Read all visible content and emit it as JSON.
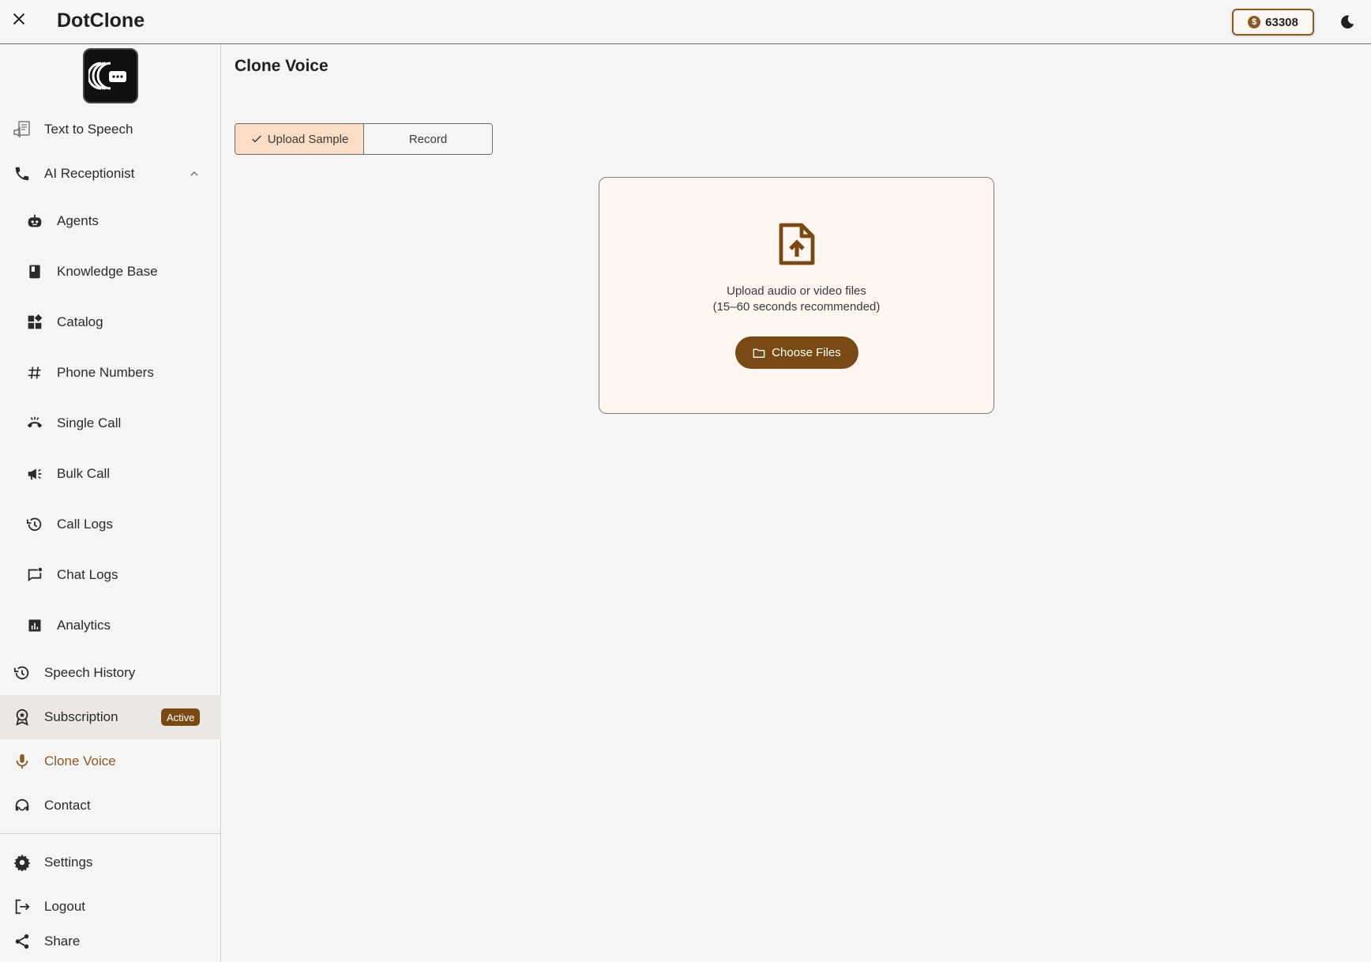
{
  "header": {
    "title": "DotClone",
    "credits": "63308",
    "close_icon": "close-icon",
    "theme_icon": "moon-icon"
  },
  "sidebar": {
    "items": [
      {
        "label": "Text to Speech",
        "icon": "text-to-speech-icon"
      },
      {
        "label": "AI Receptionist",
        "icon": "phone-icon"
      },
      {
        "label": "Agents",
        "icon": "robot-icon"
      },
      {
        "label": "Knowledge Base",
        "icon": "book-icon"
      },
      {
        "label": "Catalog",
        "icon": "widgets-icon"
      },
      {
        "label": "Phone Numbers",
        "icon": "hash-icon"
      },
      {
        "label": "Single Call",
        "icon": "call-end-icon"
      },
      {
        "label": "Bulk Call",
        "icon": "megaphone-icon"
      },
      {
        "label": "Call Logs",
        "icon": "history-icon"
      },
      {
        "label": "Chat Logs",
        "icon": "chat-icon"
      },
      {
        "label": "Analytics",
        "icon": "analytics-icon"
      },
      {
        "label": "Speech History",
        "icon": "history-icon"
      },
      {
        "label": "Subscription",
        "icon": "award-icon",
        "badge": "Active"
      },
      {
        "label": "Clone Voice",
        "icon": "mic-icon"
      },
      {
        "label": "Contact",
        "icon": "support-icon"
      },
      {
        "label": "Settings",
        "icon": "gear-icon"
      },
      {
        "label": "Logout",
        "icon": "logout-icon"
      },
      {
        "label": "Share",
        "icon": "share-icon"
      }
    ]
  },
  "main": {
    "title": "Clone Voice",
    "tabs": [
      {
        "label": "Upload Sample",
        "selected": true
      },
      {
        "label": "Record",
        "selected": false
      }
    ],
    "upload": {
      "line1": "Upload audio or video files",
      "line2": "(15–60 seconds recommended)",
      "button": "Choose Files"
    }
  },
  "colors": {
    "accent": "#8a5a22",
    "accent_dark": "#7a4a14",
    "tab_selected_bg": "#fbdcc4",
    "upload_bg": "#fff6f2"
  }
}
